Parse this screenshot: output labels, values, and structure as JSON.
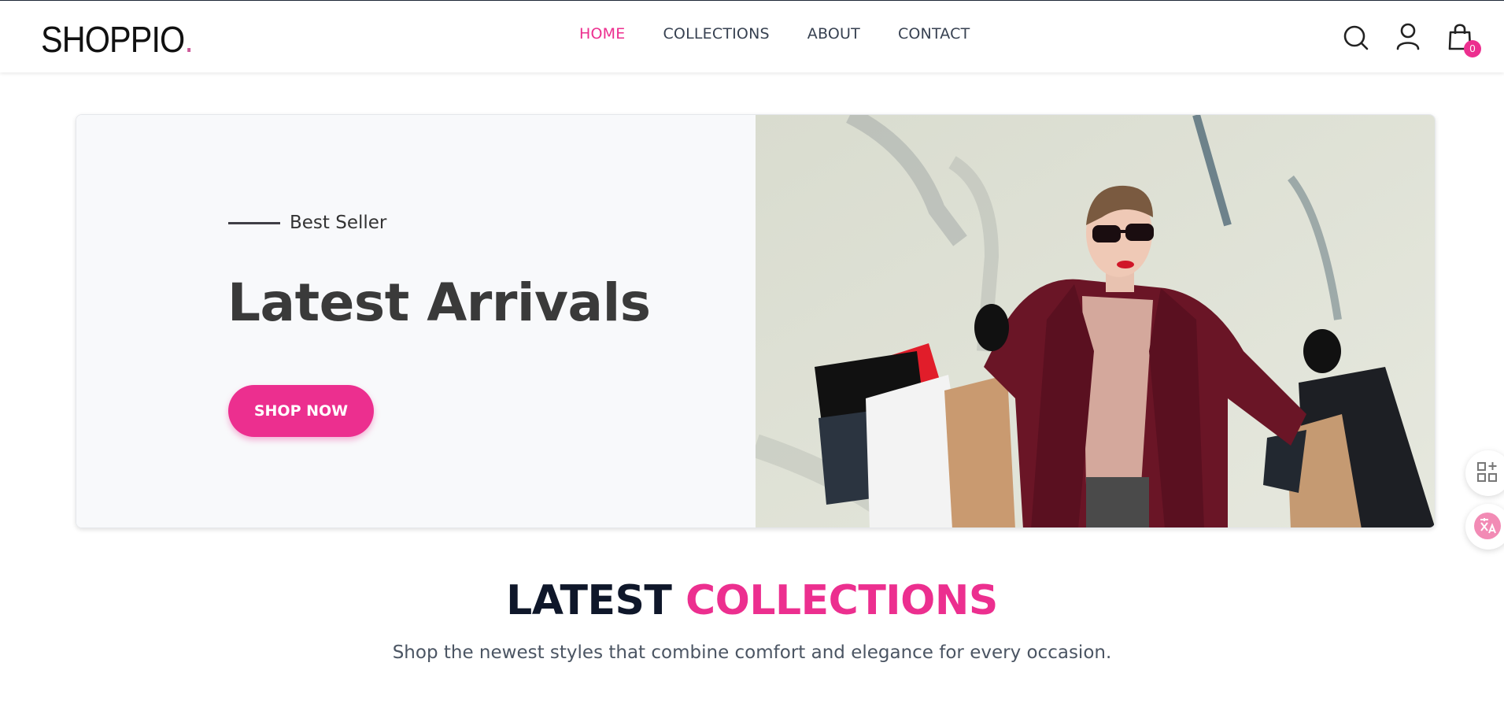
{
  "brand": {
    "name": "SHOPPIO",
    "dot": "."
  },
  "nav": {
    "items": [
      {
        "label": "HOME",
        "active": true
      },
      {
        "label": "COLLECTIONS",
        "active": false
      },
      {
        "label": "ABOUT",
        "active": false
      },
      {
        "label": "CONTACT",
        "active": false
      }
    ]
  },
  "header_icons": [
    "search-icon",
    "user-icon",
    "shopping-bag-icon"
  ],
  "cart": {
    "count": "0"
  },
  "hero": {
    "eyebrow": "Best Seller",
    "title": "Latest Arrivals",
    "cta_label": "SHOP NOW",
    "image_alt": "Woman in red coat carrying shopping bags"
  },
  "collections": {
    "title_part1": "LATEST",
    "title_part2": "COLLECTIONS",
    "subtitle": "Shop the newest styles that combine comfort and elegance for every occasion."
  },
  "side_widgets": [
    "grid-apps-icon",
    "translate-icon"
  ],
  "colors": {
    "accent": "#ec2f8f",
    "logo_dot": "#cc5a9a",
    "text_dark": "#0f172a"
  }
}
